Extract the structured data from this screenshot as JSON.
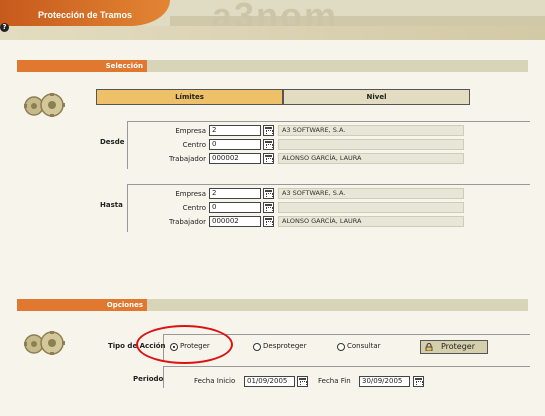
{
  "header": {
    "title": "Protección de Tramos",
    "logo": "a3nom"
  },
  "help_icon": "question-icon",
  "seleccion": {
    "section_title": "Selección",
    "tabs": [
      {
        "label": "Límites",
        "active": true
      },
      {
        "label": "Nivel",
        "active": false
      }
    ],
    "desde": {
      "label": "Desde",
      "empresa_label": "Empresa",
      "empresa_value": "2",
      "empresa_desc": "A3 SOFTWARE, S.A.",
      "centro_label": "Centro",
      "centro_value": "0",
      "centro_desc": "",
      "trabajador_label": "Trabajador",
      "trabajador_value": "000002",
      "trabajador_desc": "ALONSO GARCÍA, LAURA"
    },
    "hasta": {
      "label": "Hasta",
      "empresa_label": "Empresa",
      "empresa_value": "2",
      "empresa_desc": "A3 SOFTWARE, S.A.",
      "centro_label": "Centro",
      "centro_value": "0",
      "centro_desc": "",
      "trabajador_label": "Trabajador",
      "trabajador_value": "000002",
      "trabajador_desc": "ALONSO GARCÍA, LAURA"
    }
  },
  "opciones": {
    "section_title": "Opciones",
    "tipo_accion_label": "Tipo de Acción",
    "radios": [
      {
        "label": "Proteger",
        "checked": true
      },
      {
        "label": "Desproteger",
        "checked": false
      },
      {
        "label": "Consultar",
        "checked": false
      }
    ],
    "action_button": "Proteger",
    "periodo_label": "Periodo",
    "fecha_inicio_label": "Fecha Inicio",
    "fecha_inicio_value": "01/09/2005",
    "fecha_fin_label": "Fecha Fin",
    "fecha_fin_value": "30/09/2005"
  },
  "colors": {
    "accent": "#e07830",
    "tab_active": "#eec068",
    "highlight_oval": "#d11111"
  }
}
